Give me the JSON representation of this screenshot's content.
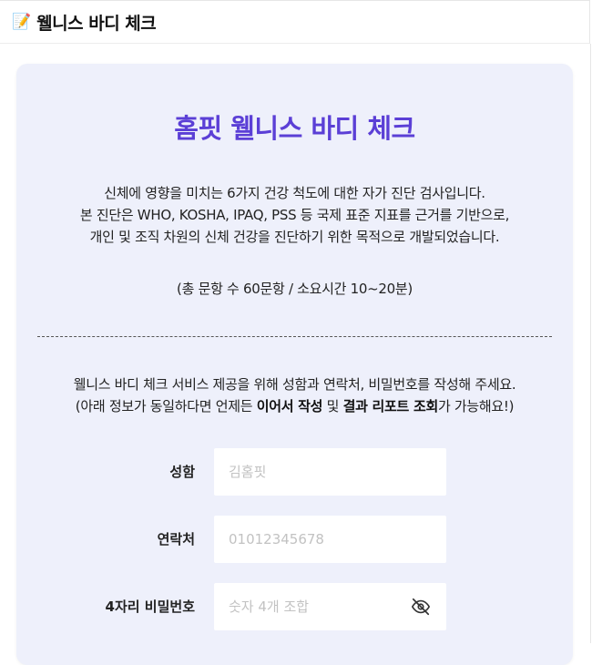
{
  "header": {
    "emoji": "📝",
    "title": "웰니스 바디 체크"
  },
  "card": {
    "title": "홈핏 웰니스 바디 체크",
    "description_lines": [
      "신체에 영향을 미치는 6가지 건강 척도에 대한 자가 진단 검사입니다.",
      "본 진단은 WHO, KOSHA, IPAQ, PSS 등 국제 표준 지표를 근거를 기반으로,",
      "개인 및 조직 차원의 신체 건강을 진단하기 위한 목적으로 개발되었습니다."
    ],
    "total": "(총 문항 수 60문항 / 소요시간 10~20분)",
    "info_line1": "웰니스 바디 체크 서비스 제공을 위해 성함과 연락처, 비밀번호를 작성해 주세요.",
    "info_line2": {
      "part1": "(아래 정보가 동일하다면 언제든 ",
      "bold1": "이어서 작성",
      "part2": " 및 ",
      "bold2": "결과 리포트 조회",
      "part3": "가 가능해요!)"
    }
  },
  "form": {
    "name": {
      "label": "성함",
      "placeholder": "김홈핏"
    },
    "phone": {
      "label": "연락처",
      "placeholder": "01012345678"
    },
    "password": {
      "label": "4자리 비밀번호",
      "placeholder": "숫자 4개 조합",
      "toggle_icon": "eye-off-icon"
    }
  }
}
